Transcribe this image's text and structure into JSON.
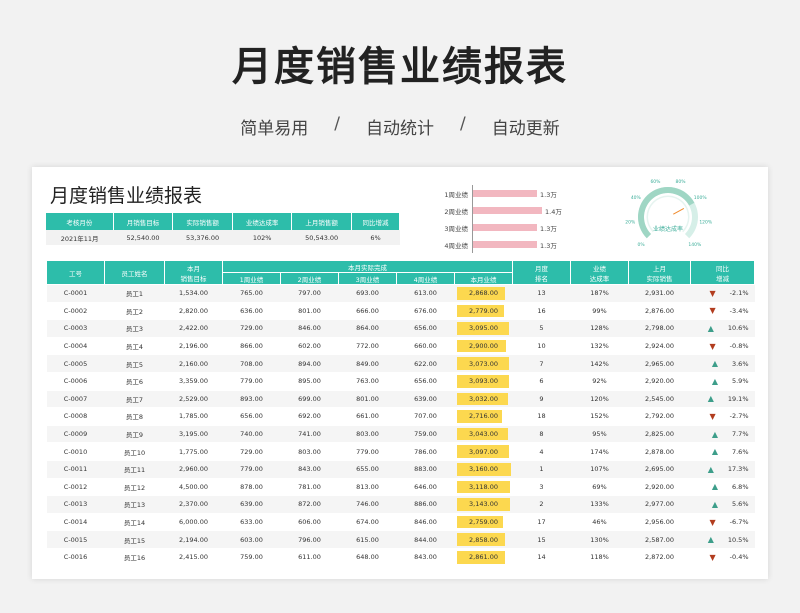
{
  "hero": {
    "title": "月度销售业绩报表",
    "tags": [
      "简单易用",
      "自动统计",
      "自动更新"
    ],
    "separator": "/"
  },
  "report": {
    "title": "月度销售业绩报表",
    "summary": {
      "headers": [
        "考核月份",
        "月销售目标",
        "实际销售额",
        "业绩达成率",
        "上月销售额",
        "同比增减"
      ],
      "values": [
        "2021年11月",
        "52,540.00",
        "53,376.00",
        "102%",
        "50,543.00",
        "6%"
      ]
    },
    "weekly_bars": [
      {
        "label": "1周业绩",
        "value_text": "1.3万",
        "value": 1.3
      },
      {
        "label": "2周业绩",
        "value_text": "1.4万",
        "value": 1.4
      },
      {
        "label": "3周业绩",
        "value_text": "1.3万",
        "value": 1.3
      },
      {
        "label": "4周业绩",
        "value_text": "1.3万",
        "value": 1.3
      }
    ],
    "gauge": {
      "label": "业绩达成率",
      "ticks": [
        "0%",
        "20%",
        "40%",
        "60%",
        "80%",
        "100%",
        "120%",
        "140%"
      ],
      "value_percent": 102,
      "max_percent": 140
    },
    "table": {
      "headers": {
        "id": "工号",
        "name": "员工姓名",
        "target": "本月\n销售目标",
        "actual_group": "本月实际完成",
        "w1": "1周业绩",
        "w2": "2周业绩",
        "w3": "3周业绩",
        "w4": "4周业绩",
        "month": "本月业绩",
        "rank": "月度\n排名",
        "rate": "业绩\n达成率",
        "last": "上月\n实际销售",
        "yoy": "同比\n增减"
      },
      "rows": [
        {
          "id": "C-0001",
          "name": "员工1",
          "target": "1,534.00",
          "w1": "765.00",
          "w2": "797.00",
          "w3": "693.00",
          "w4": "613.00",
          "month": "2,868.00",
          "rank": "13",
          "rate": "187%",
          "last": "2,931.00",
          "yoy": "-2.1%",
          "dir": "down"
        },
        {
          "id": "C-0002",
          "name": "员工2",
          "target": "2,820.00",
          "w1": "636.00",
          "w2": "801.00",
          "w3": "666.00",
          "w4": "676.00",
          "month": "2,779.00",
          "rank": "16",
          "rate": "99%",
          "last": "2,876.00",
          "yoy": "-3.4%",
          "dir": "down"
        },
        {
          "id": "C-0003",
          "name": "员工3",
          "target": "2,422.00",
          "w1": "729.00",
          "w2": "846.00",
          "w3": "864.00",
          "w4": "656.00",
          "month": "3,095.00",
          "rank": "5",
          "rate": "128%",
          "last": "2,798.00",
          "yoy": "10.6%",
          "dir": "up"
        },
        {
          "id": "C-0004",
          "name": "员工4",
          "target": "2,196.00",
          "w1": "866.00",
          "w2": "602.00",
          "w3": "772.00",
          "w4": "660.00",
          "month": "2,900.00",
          "rank": "10",
          "rate": "132%",
          "last": "2,924.00",
          "yoy": "-0.8%",
          "dir": "down"
        },
        {
          "id": "C-0005",
          "name": "员工5",
          "target": "2,160.00",
          "w1": "708.00",
          "w2": "894.00",
          "w3": "849.00",
          "w4": "622.00",
          "month": "3,073.00",
          "rank": "7",
          "rate": "142%",
          "last": "2,965.00",
          "yoy": "3.6%",
          "dir": "up"
        },
        {
          "id": "C-0006",
          "name": "员工6",
          "target": "3,359.00",
          "w1": "779.00",
          "w2": "895.00",
          "w3": "763.00",
          "w4": "656.00",
          "month": "3,093.00",
          "rank": "6",
          "rate": "92%",
          "last": "2,920.00",
          "yoy": "5.9%",
          "dir": "up"
        },
        {
          "id": "C-0007",
          "name": "员工7",
          "target": "2,529.00",
          "w1": "893.00",
          "w2": "699.00",
          "w3": "801.00",
          "w4": "639.00",
          "month": "3,032.00",
          "rank": "9",
          "rate": "120%",
          "last": "2,545.00",
          "yoy": "19.1%",
          "dir": "up"
        },
        {
          "id": "C-0008",
          "name": "员工8",
          "target": "1,785.00",
          "w1": "656.00",
          "w2": "692.00",
          "w3": "661.00",
          "w4": "707.00",
          "month": "2,716.00",
          "rank": "18",
          "rate": "152%",
          "last": "2,792.00",
          "yoy": "-2.7%",
          "dir": "down"
        },
        {
          "id": "C-0009",
          "name": "员工9",
          "target": "3,195.00",
          "w1": "740.00",
          "w2": "741.00",
          "w3": "803.00",
          "w4": "759.00",
          "month": "3,043.00",
          "rank": "8",
          "rate": "95%",
          "last": "2,825.00",
          "yoy": "7.7%",
          "dir": "up"
        },
        {
          "id": "C-0010",
          "name": "员工10",
          "target": "1,775.00",
          "w1": "729.00",
          "w2": "803.00",
          "w3": "779.00",
          "w4": "786.00",
          "month": "3,097.00",
          "rank": "4",
          "rate": "174%",
          "last": "2,878.00",
          "yoy": "7.6%",
          "dir": "up"
        },
        {
          "id": "C-0011",
          "name": "员工11",
          "target": "2,960.00",
          "w1": "779.00",
          "w2": "843.00",
          "w3": "655.00",
          "w4": "883.00",
          "month": "3,160.00",
          "rank": "1",
          "rate": "107%",
          "last": "2,695.00",
          "yoy": "17.3%",
          "dir": "up"
        },
        {
          "id": "C-0012",
          "name": "员工12",
          "target": "4,500.00",
          "w1": "878.00",
          "w2": "781.00",
          "w3": "813.00",
          "w4": "646.00",
          "month": "3,118.00",
          "rank": "3",
          "rate": "69%",
          "last": "2,920.00",
          "yoy": "6.8%",
          "dir": "up"
        },
        {
          "id": "C-0013",
          "name": "员工13",
          "target": "2,370.00",
          "w1": "639.00",
          "w2": "872.00",
          "w3": "746.00",
          "w4": "886.00",
          "month": "3,143.00",
          "rank": "2",
          "rate": "133%",
          "last": "2,977.00",
          "yoy": "5.6%",
          "dir": "up"
        },
        {
          "id": "C-0014",
          "name": "员工14",
          "target": "6,000.00",
          "w1": "633.00",
          "w2": "606.00",
          "w3": "674.00",
          "w4": "846.00",
          "month": "2,759.00",
          "rank": "17",
          "rate": "46%",
          "last": "2,956.00",
          "yoy": "-6.7%",
          "dir": "down"
        },
        {
          "id": "C-0015",
          "name": "员工15",
          "target": "2,194.00",
          "w1": "603.00",
          "w2": "796.00",
          "w3": "615.00",
          "w4": "844.00",
          "month": "2,858.00",
          "rank": "15",
          "rate": "130%",
          "last": "2,587.00",
          "yoy": "10.5%",
          "dir": "up"
        },
        {
          "id": "C-0016",
          "name": "员工16",
          "target": "2,415.00",
          "w1": "759.00",
          "w2": "611.00",
          "w3": "648.00",
          "w4": "843.00",
          "month": "2,861.00",
          "rank": "14",
          "rate": "118%",
          "last": "2,872.00",
          "yoy": "-0.4%",
          "dir": "down"
        }
      ]
    },
    "colors": {
      "header": "#2dbdaa",
      "bar": "#f2b7c0",
      "highlight": "#fcd84f",
      "up": "#3d9e8a",
      "down": "#b23c1e"
    }
  }
}
